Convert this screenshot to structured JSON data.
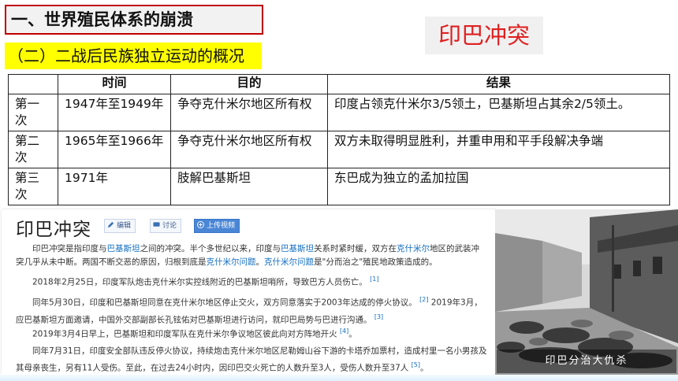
{
  "header": {
    "section_title": "一、世界殖民体系的崩溃",
    "subtitle": "（二）二战后民族独立运动的概况",
    "banner": "印巴冲突"
  },
  "table": {
    "columns": [
      "",
      "时间",
      "目的",
      "结果"
    ],
    "rows": [
      {
        "label": "第一次",
        "time": "1947年至1949年",
        "goal": "争夺克什米尔地区所有权",
        "result": "印度占领克什米尔3/5领土，巴基斯坦占其余2/5领土。"
      },
      {
        "label": "第二次",
        "time": "1965年至1966年",
        "goal": "争夺克什米尔地区所有权",
        "result": "双方未取得明显胜利，并重申用和平手段解决争端"
      },
      {
        "label": "第三次",
        "time": "1971年",
        "goal": "肢解巴基斯坦",
        "result": "东巴成为独立的孟加拉国"
      }
    ]
  },
  "wiki": {
    "title": "印巴冲突",
    "buttons": {
      "edit": "编辑",
      "discuss": "讨论",
      "upload": "上传视频"
    },
    "p1": {
      "a": "印巴冲突是指印度与",
      "link1": "巴基斯坦",
      "b": "之间的冲突。半个多世纪以来，印度与",
      "link2": "巴基斯坦",
      "c": "关系时紧时缓，双方在",
      "link3": "克什米尔",
      "d": "地区的武装冲突几乎从未中断。两国不断交恶的原因，归根到底是",
      "link4": "克什米尔问题",
      "e": "。",
      "link5": "克什米尔问题",
      "f": "是\"分而治之\"殖民地政策造成的。"
    },
    "p2": {
      "text": "2018年2月25日，印度军队炮击克什米尔实控线附近的巴基斯坦哨所，导致巴方人员伤亡。",
      "ref": "[1]"
    },
    "p3": {
      "text1": "同年5月30日，印度和巴基斯坦同意在克什米尔地区停止交火，双方同意落实于2003年达成的停火协议。",
      "ref1": "[2]",
      "text2": "2019年3月，应巴基斯坦方面邀请，中国外交部副部长孔铉佑对巴基斯坦进行访问，就印巴局势与巴进行沟通。",
      "ref2": "[3]"
    },
    "p4": {
      "text": "2019年3月4日早上，巴基斯坦和印度军队在克什米尔争议地区彼此向对方阵地开火",
      "ref": "[4]",
      "end": "。"
    },
    "p5": {
      "text": "同年7月31日，印度安全部队违反停火协议，持续炮击克什米尔地区尼勒姆山谷下游的卡塔乔加票村，造成村里一名小男孩及其母亲丧生，另有11人受伤。至此，在过去24小时内，因印巴交火死亡的人数升至3人，受伤人数升至37人",
      "ref": "[5]",
      "end": "。"
    }
  },
  "photo": {
    "caption": "印巴分治大仇杀"
  },
  "colors": {
    "section_border": "#c00000",
    "subtitle_bg": "#ffff00",
    "banner_text": "#e02020",
    "link": "#136ec2"
  }
}
